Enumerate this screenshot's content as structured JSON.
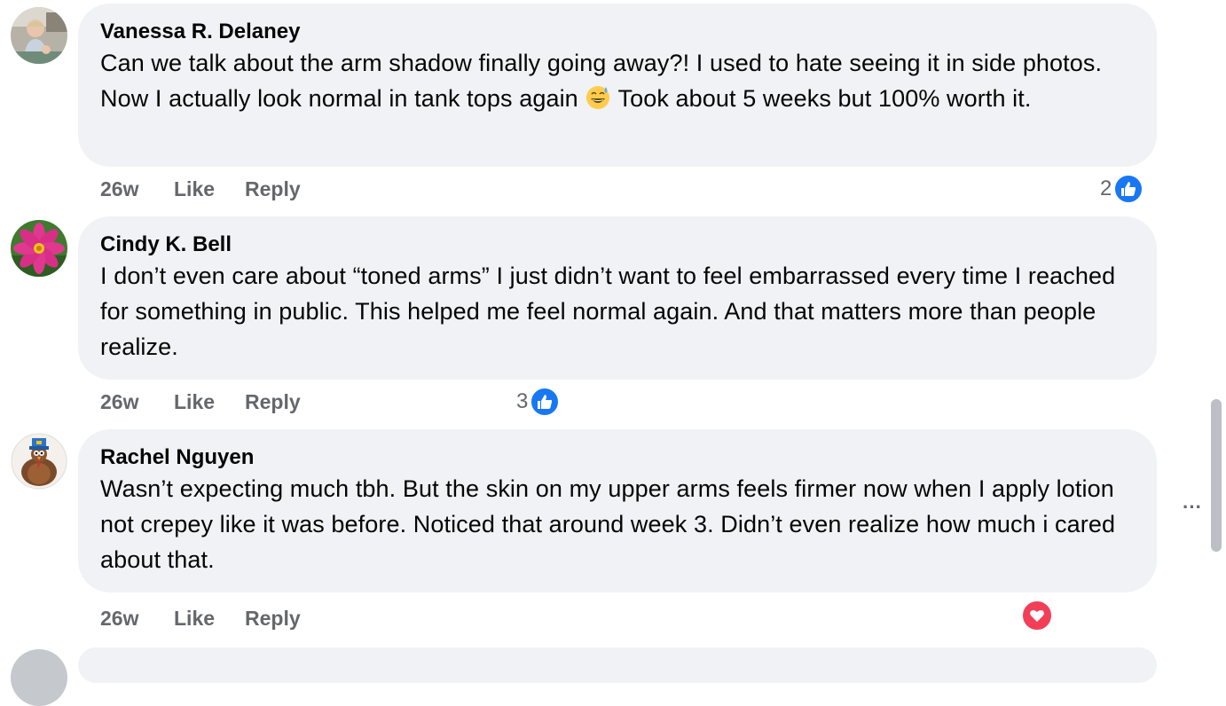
{
  "comments": [
    {
      "author": "Vanessa R. Delaney",
      "text_before_emoji": "Can we talk about the arm shadow finally going away?! I used to hate seeing it in side photos. Now I actually look normal in tank tops again ",
      "emoji": "grinning-sweat-emoji",
      "text_after_emoji": " Took about 5 weeks but 100% worth it.",
      "time": "26w",
      "like_label": "Like",
      "reply_label": "Reply",
      "reaction_count": "2",
      "reaction_type": "like-icon",
      "avatar": "child-photo-avatar"
    },
    {
      "author": "Cindy K. Bell",
      "text": "I don’t even care about “toned arms” I just didn’t want to feel embarrassed every time I reached for something in public. This helped me feel normal again. And that matters more than people realize.",
      "time": "26w",
      "like_label": "Like",
      "reply_label": "Reply",
      "reaction_count": "3",
      "reaction_type": "like-icon",
      "avatar": "pink-flower-avatar"
    },
    {
      "author": "Rachel Nguyen",
      "text": "Wasn’t expecting much tbh. But the skin on my upper arms feels firmer now when I apply lotion not crepey like it was before. Noticed that around week 3. Didn’t even realize how much i cared about that.",
      "time": "26w",
      "like_label": "Like",
      "reply_label": "Reply",
      "reaction_count": "",
      "reaction_type": "heart-icon",
      "avatar": "turkey-avatar"
    }
  ],
  "more_options_label": "···",
  "colors": {
    "bubble": "#f0f2f5",
    "meta_text": "#65676b",
    "like_blue": "#1877f2",
    "heart_red": "#f33e58"
  }
}
